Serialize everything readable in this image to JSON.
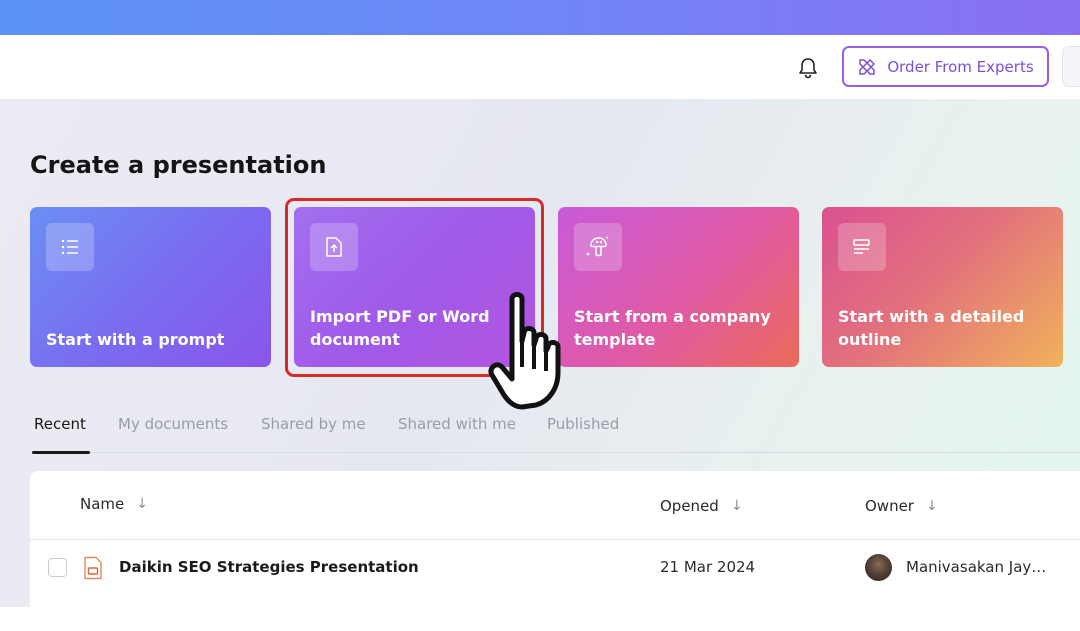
{
  "header": {
    "notification_icon": "bell-icon",
    "order_button": {
      "label": "Order From Experts",
      "icon": "pen-ruler-icon",
      "color": "#7c4ddb"
    }
  },
  "main": {
    "title": "Create a presentation",
    "cards": [
      {
        "label": "Start with a prompt",
        "icon": "list-icon"
      },
      {
        "label": "Import PDF or Word document",
        "icon": "file-upload-icon"
      },
      {
        "label": "Start from a company template",
        "icon": "mushroom-sparkle-icon"
      },
      {
        "label": "Start with a detailed outline",
        "icon": "outline-icon"
      }
    ],
    "highlight_color": "#d62a2a",
    "tabs": [
      {
        "label": "Recent",
        "active": true
      },
      {
        "label": "My documents",
        "active": false
      },
      {
        "label": "Shared by me",
        "active": false
      },
      {
        "label": "Shared with me",
        "active": false
      },
      {
        "label": "Published",
        "active": false
      }
    ],
    "table": {
      "columns": [
        {
          "label": "Name",
          "sort": "↓"
        },
        {
          "label": "Opened",
          "sort": "↓"
        },
        {
          "label": "Owner",
          "sort": "↓"
        }
      ],
      "rows": [
        {
          "name": "Daikin SEO Strategies Presentation",
          "opened": "21 Mar 2024",
          "owner": "Manivasakan Jay…",
          "file_icon": "presentation-file-icon"
        }
      ]
    }
  }
}
